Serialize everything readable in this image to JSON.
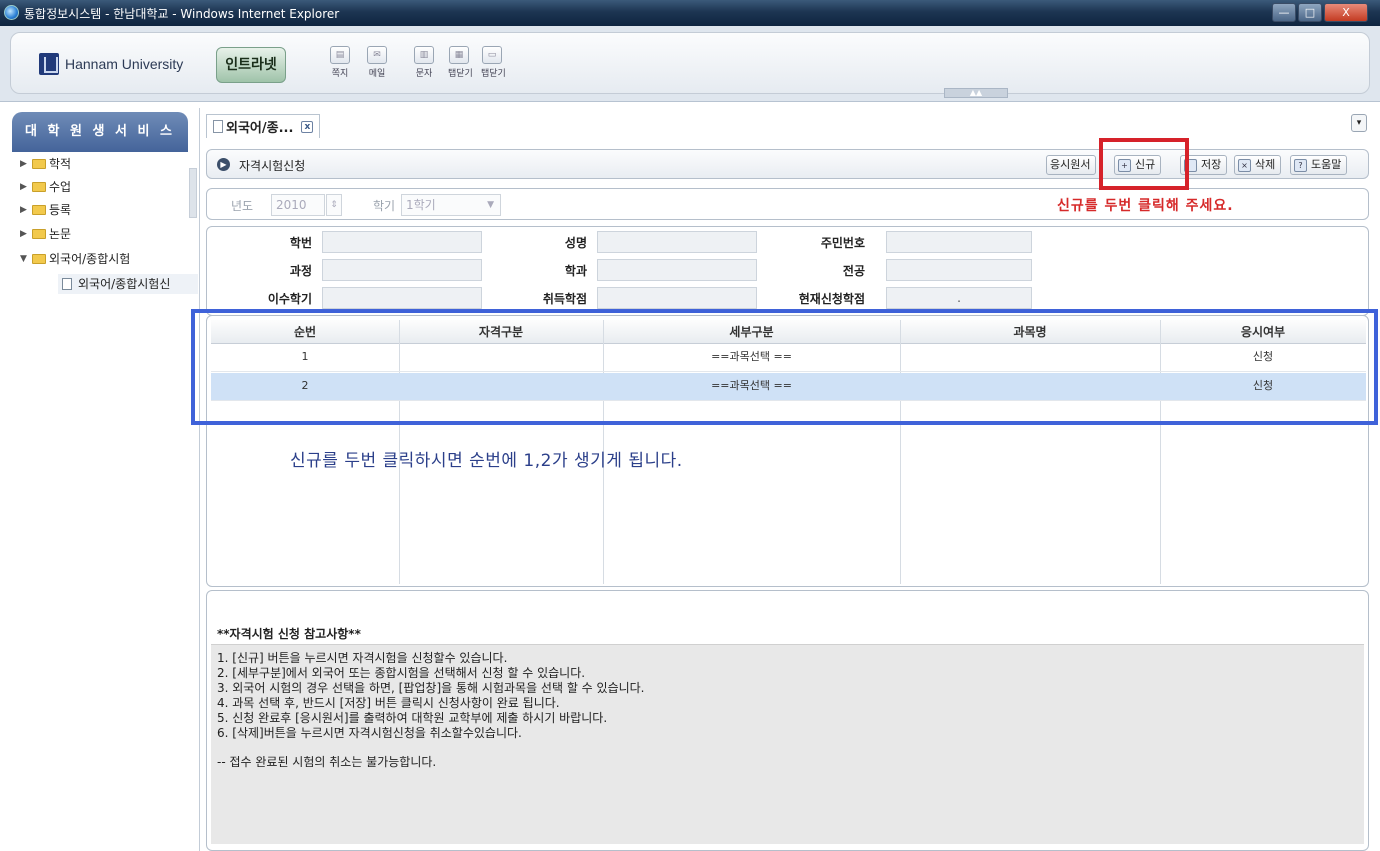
{
  "window": {
    "title": "통합정보시스템 - 한남대학교 - Windows Internet Explorer",
    "min": "—",
    "max": "□",
    "close": "X"
  },
  "header": {
    "logo_text": "Hannam University",
    "intranet_label": "인트라넷",
    "tools": [
      "쪽지",
      "메일",
      "문자",
      "탭닫기",
      "탭닫기"
    ]
  },
  "sidebar": {
    "title": "대 학 원 생 서 비 스",
    "items": [
      {
        "label": "학적",
        "expanded": false
      },
      {
        "label": "수업",
        "expanded": false
      },
      {
        "label": "등록",
        "expanded": false
      },
      {
        "label": "논문",
        "expanded": false
      },
      {
        "label": "외국어/종합시험",
        "expanded": true
      }
    ],
    "leaf": "외국어/종합시험신"
  },
  "tab": {
    "label": "외국어/종...",
    "close": "x",
    "dropdown": "▾"
  },
  "panel": {
    "title": "자격시험신청",
    "buttons": {
      "exam_form": "응시원서",
      "new": "신규",
      "save": "저장",
      "delete": "삭제",
      "help": "도움말"
    }
  },
  "search": {
    "year_label": "년도",
    "year_value": "2010",
    "term_label": "학기",
    "term_value": "1학기"
  },
  "info": {
    "student_no": "학번",
    "name": "성명",
    "resident_no": "주민번호",
    "course": "과정",
    "department": "학과",
    "major": "전공",
    "completed_terms": "이수학기",
    "earned_credits": "취득학점",
    "current_credits": "현재신청학점",
    "current_credits_value": "."
  },
  "grid": {
    "headers": [
      "순번",
      "자격구분",
      "세부구분",
      "과목명",
      "응시여부"
    ],
    "rows": [
      {
        "no": "1",
        "category": "",
        "detail": "==과목선택 ==",
        "subject": "",
        "status": "신청"
      },
      {
        "no": "2",
        "category": "",
        "detail": "==과목선택 ==",
        "subject": "",
        "status": "신청"
      }
    ]
  },
  "annotations": {
    "red_note": "신규를 두번 클릭해 주세요.",
    "blue_note": "신규를 두번 클릭하시면 순번에 1,2가 생기게 됩니다."
  },
  "notes": {
    "title": "**자격시험 신청 참고사항**",
    "lines": [
      "1. [신규] 버튼을 누르시면 자격시험을 신청할수 있습니다.",
      "2. [세부구분]에서 외국어 또는 종합시험을 선택해서 신청 할 수 있습니다.",
      "3. 외국어 시험의 경우 선택을 하면, [팝업창]을 통해 시험과목을 선택 할 수 있습니다.",
      "4. 과목 선택 후, 반드시 [저장] 버튼 클릭시 신청사항이 완료 됩니다.",
      "5. 신청 완료후 [응시원서]를 출력하여 대학원 교학부에 제출 하시기 바랍니다.",
      "6. [삭제]버튼을 누르시면 자격시험신청을 취소할수있습니다."
    ],
    "footer": "-- 접수 완료된 시험의 취소는 불가능합니다."
  },
  "colors": {
    "titlebar": "#1d3552",
    "sidebar_header": "#44649a",
    "selected_row": "#cfe1f6",
    "red_annotation": "#d6222a",
    "blue_annotation": "#3f62d9"
  }
}
